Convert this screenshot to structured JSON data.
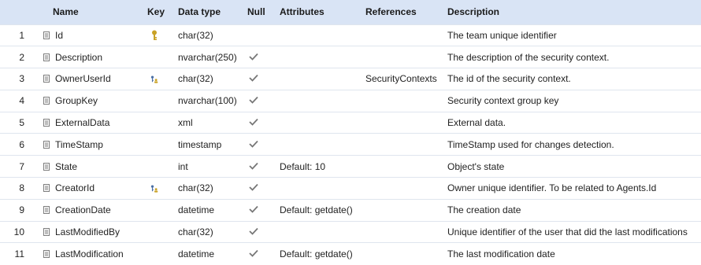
{
  "headers": {
    "name": "Name",
    "key": "Key",
    "data_type": "Data type",
    "null": "Null",
    "attributes": "Attributes",
    "references": "References",
    "description": "Description"
  },
  "rows": [
    {
      "num": "1",
      "name": "Id",
      "key": "primary-key-icon",
      "type": "char(32)",
      "nullable": false,
      "attributes": "",
      "references": "",
      "description": "The team unique identifier"
    },
    {
      "num": "2",
      "name": "Description",
      "key": "",
      "type": "nvarchar(250)",
      "nullable": true,
      "attributes": "",
      "references": "",
      "description": "The description of the security context."
    },
    {
      "num": "3",
      "name": "OwnerUserId",
      "key": "foreign-key-icon",
      "type": "char(32)",
      "nullable": true,
      "attributes": "",
      "references": "SecurityContexts",
      "description": "The id of the security context."
    },
    {
      "num": "4",
      "name": "GroupKey",
      "key": "",
      "type": "nvarchar(100)",
      "nullable": true,
      "attributes": "",
      "references": "",
      "description": "Security context group key"
    },
    {
      "num": "5",
      "name": "ExternalData",
      "key": "",
      "type": "xml",
      "nullable": true,
      "attributes": "",
      "references": "",
      "description": "External data."
    },
    {
      "num": "6",
      "name": "TimeStamp",
      "key": "",
      "type": "timestamp",
      "nullable": true,
      "attributes": "",
      "references": "",
      "description": "TimeStamp used for changes detection."
    },
    {
      "num": "7",
      "name": "State",
      "key": "",
      "type": "int",
      "nullable": true,
      "attributes": "Default: 10",
      "references": "",
      "description": "Object's state"
    },
    {
      "num": "8",
      "name": "CreatorId",
      "key": "foreign-key-icon",
      "type": "char(32)",
      "nullable": true,
      "attributes": "",
      "references": "",
      "description": "Owner unique identifier. To be related to Agents.Id"
    },
    {
      "num": "9",
      "name": "CreationDate",
      "key": "",
      "type": "datetime",
      "nullable": true,
      "attributes": "Default: getdate()",
      "references": "",
      "description": "The creation date"
    },
    {
      "num": "10",
      "name": "LastModifiedBy",
      "key": "",
      "type": "char(32)",
      "nullable": true,
      "attributes": "",
      "references": "",
      "description": "Unique identifier of the user that did the last modifications"
    },
    {
      "num": "11",
      "name": "LastModification",
      "key": "",
      "type": "datetime",
      "nullable": true,
      "attributes": "Default: getdate()",
      "references": "",
      "description": "The last modification date"
    }
  ],
  "colors": {
    "header_bg": "#d9e4f5",
    "row_border": "#dfe5ee",
    "primary_key": "#c9a227",
    "foreign_key": "#4a6fa5",
    "check": "#777777"
  }
}
